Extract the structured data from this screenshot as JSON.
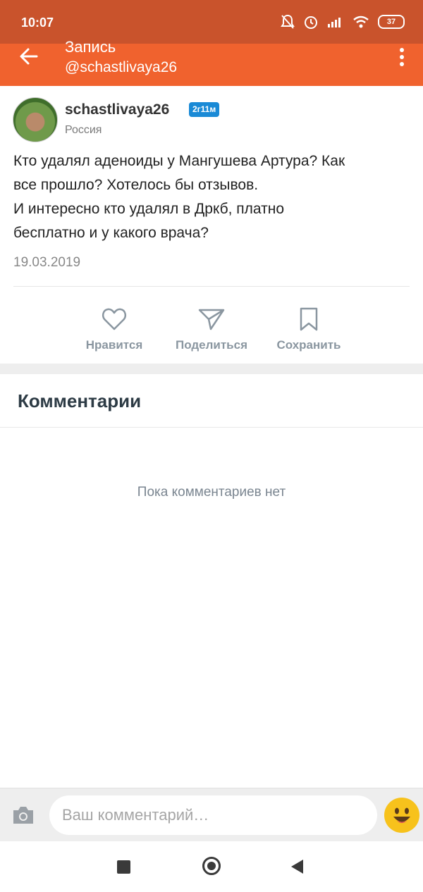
{
  "status": {
    "time": "10:07",
    "battery": "37"
  },
  "app_bar": {
    "title": "Запись",
    "subtitle": "@schastlivaya26"
  },
  "post": {
    "author": "schastlivaya26",
    "badge": "2г11м",
    "location": "Россия",
    "text_lines": [
      "Кто удалял аденоиды у Мангушева Артура?  Как",
      "все прошло?  Хотелось бы отзывов.",
      "И интересно кто удалял в Дркб, платно",
      "бесплатно и у какого врача?"
    ],
    "date": "19.03.2019"
  },
  "actions": {
    "like": "Нравится",
    "share": "Поделиться",
    "save": "Сохранить"
  },
  "comments": {
    "title": "Комментарии",
    "empty": "Пока комментариев нет"
  },
  "input": {
    "placeholder": "Ваш комментарий…"
  },
  "colors": {
    "status_bar": "#c9532c",
    "app_bar": "#f0622e",
    "badge": "#1a8ad6",
    "emoji": "#f7c21c"
  },
  "icons": {
    "back": "arrow-left-icon",
    "more": "more-vertical-icon",
    "like": "heart-icon",
    "share": "paper-plane-icon",
    "save": "bookmark-icon",
    "camera": "camera-icon",
    "emoji": "smiley-icon"
  }
}
